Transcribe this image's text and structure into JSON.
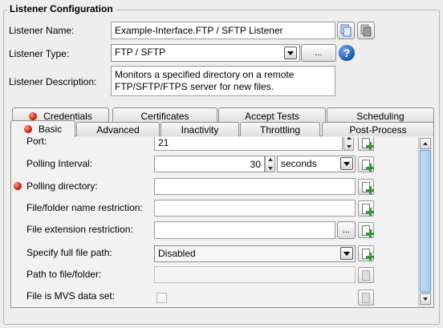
{
  "section": {
    "title": "Listener Configuration"
  },
  "listener": {
    "name_label": "Listener Name:",
    "name_value": "Example-Interface.FTP / SFTP Listener",
    "type_label": "Listener Type:",
    "type_value": "FTP / SFTP",
    "type_browse_label": "...",
    "description_label": "Listener Description:",
    "description_line1": "Monitors a specified directory on a remote",
    "description_line2": "FTP/SFTP/FTPS server for new files."
  },
  "tabs_back": [
    {
      "label": "Credentials",
      "error": true
    },
    {
      "label": "Certificates",
      "error": false
    },
    {
      "label": "Accept Tests",
      "error": false
    },
    {
      "label": "Scheduling",
      "error": false
    }
  ],
  "tabs_front": [
    {
      "label": "Basic",
      "error": true,
      "active": true
    },
    {
      "label": "Advanced",
      "error": false,
      "active": false
    },
    {
      "label": "Inactivity",
      "error": false,
      "active": false
    },
    {
      "label": "Throttling",
      "error": false,
      "active": false
    },
    {
      "label": "Post-Process",
      "error": false,
      "active": false
    }
  ],
  "basic": {
    "port_label": "Port:",
    "port_value": "21",
    "polling_interval_label": "Polling Interval:",
    "polling_interval_value": "30",
    "polling_interval_unit": "seconds",
    "polling_directory_label": "Polling directory:",
    "polling_directory_value": "",
    "polling_directory_error": true,
    "name_restriction_label": "File/folder name restriction:",
    "name_restriction_value": "",
    "ext_restriction_label": "File extension restriction:",
    "ext_restriction_value": "",
    "ext_browse_label": "...",
    "full_path_label": "Specify full file path:",
    "full_path_value": "Disabled",
    "path_label": "Path to file/folder:",
    "path_value": "",
    "mvs_label": "File is MVS data set:",
    "mvs_checked": false
  },
  "colors": {
    "error_dot": "#d01a0a",
    "add_plus": "#2c9b2c",
    "help_icon": "#1e5fb4",
    "scroll_thumb": "#a9c8ec"
  }
}
